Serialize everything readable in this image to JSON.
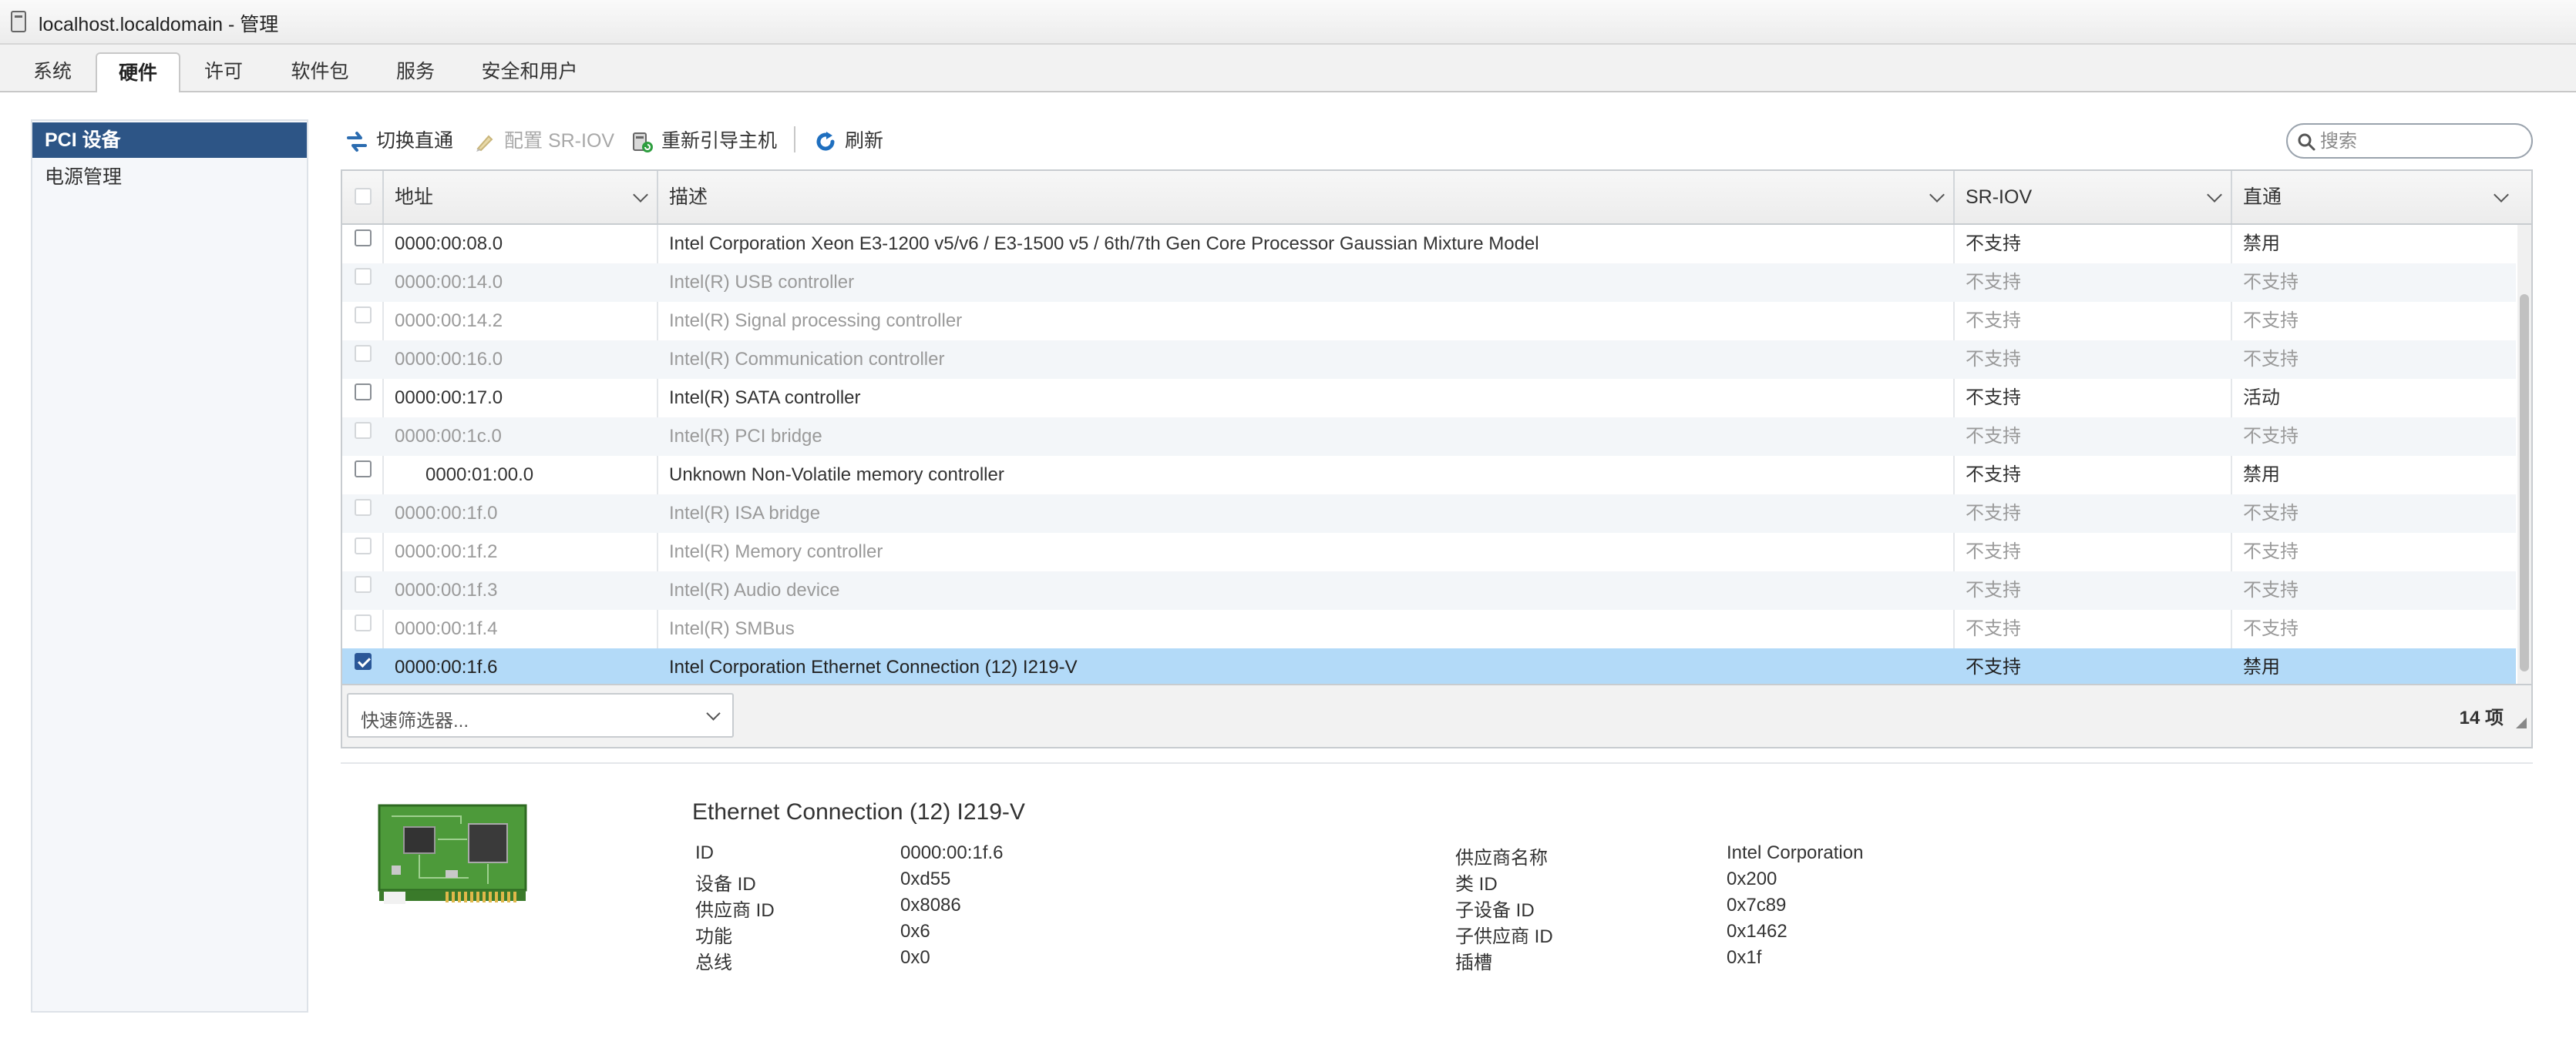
{
  "window": {
    "title": "localhost.localdomain - 管理"
  },
  "tabs": [
    {
      "label": "系统",
      "active": false
    },
    {
      "label": "硬件",
      "active": true
    },
    {
      "label": "许可",
      "active": false
    },
    {
      "label": "软件包",
      "active": false
    },
    {
      "label": "服务",
      "active": false
    },
    {
      "label": "安全和用户",
      "active": false
    }
  ],
  "sidebar": {
    "items": [
      {
        "label": "PCI 设备",
        "active": true
      },
      {
        "label": "电源管理",
        "active": false
      }
    ]
  },
  "toolbar": {
    "toggle_passthrough": "切换直通",
    "configure_sriov": "配置 SR-IOV",
    "reboot_host": "重新引导主机",
    "refresh": "刷新"
  },
  "search": {
    "placeholder": "搜索",
    "value": ""
  },
  "grid": {
    "columns": [
      "地址",
      "描述",
      "SR-IOV",
      "直通"
    ],
    "rows": [
      {
        "address": "0000:00:08.0",
        "description": "Intel Corporation Xeon E3-1200 v5/v6 / E3-1500 v5 / 6th/7th Gen Core Processor Gaussian Mixture Model",
        "sriov": "不支持",
        "passthrough": "禁用",
        "enabled": true,
        "checked": false,
        "indent": false
      },
      {
        "address": "0000:00:14.0",
        "description": "Intel(R) USB controller",
        "sriov": "不支持",
        "passthrough": "不支持",
        "enabled": false,
        "checked": false,
        "indent": false
      },
      {
        "address": "0000:00:14.2",
        "description": "Intel(R) Signal processing controller",
        "sriov": "不支持",
        "passthrough": "不支持",
        "enabled": false,
        "checked": false,
        "indent": false
      },
      {
        "address": "0000:00:16.0",
        "description": "Intel(R) Communication controller",
        "sriov": "不支持",
        "passthrough": "不支持",
        "enabled": false,
        "checked": false,
        "indent": false
      },
      {
        "address": "0000:00:17.0",
        "description": "Intel(R) SATA controller",
        "sriov": "不支持",
        "passthrough": "活动",
        "enabled": true,
        "checked": false,
        "indent": false
      },
      {
        "address": "0000:00:1c.0",
        "description": "Intel(R) PCI bridge",
        "sriov": "不支持",
        "passthrough": "不支持",
        "enabled": false,
        "checked": false,
        "indent": false
      },
      {
        "address": "0000:01:00.0",
        "description": "Unknown Non-Volatile memory controller",
        "sriov": "不支持",
        "passthrough": "禁用",
        "enabled": true,
        "checked": false,
        "indent": true
      },
      {
        "address": "0000:00:1f.0",
        "description": "Intel(R) ISA bridge",
        "sriov": "不支持",
        "passthrough": "不支持",
        "enabled": false,
        "checked": false,
        "indent": false
      },
      {
        "address": "0000:00:1f.2",
        "description": "Intel(R) Memory controller",
        "sriov": "不支持",
        "passthrough": "不支持",
        "enabled": false,
        "checked": false,
        "indent": false
      },
      {
        "address": "0000:00:1f.3",
        "description": "Intel(R) Audio device",
        "sriov": "不支持",
        "passthrough": "不支持",
        "enabled": false,
        "checked": false,
        "indent": false
      },
      {
        "address": "0000:00:1f.4",
        "description": "Intel(R) SMBus",
        "sriov": "不支持",
        "passthrough": "不支持",
        "enabled": false,
        "checked": false,
        "indent": false
      },
      {
        "address": "0000:00:1f.6",
        "description": "Intel Corporation Ethernet Connection (12) I219-V",
        "sriov": "不支持",
        "passthrough": "禁用",
        "enabled": true,
        "checked": true,
        "indent": false
      }
    ],
    "quick_filter": "快速筛选器...",
    "item_count": "14 项"
  },
  "details": {
    "title": "Ethernet Connection (12) I219-V",
    "left": [
      {
        "key": "ID",
        "value": "0000:00:1f.6"
      },
      {
        "key": "设备 ID",
        "value": "0xd55"
      },
      {
        "key": "供应商 ID",
        "value": "0x8086"
      },
      {
        "key": "功能",
        "value": "0x6"
      },
      {
        "key": "总线",
        "value": "0x0"
      }
    ],
    "right": [
      {
        "key": "供应商名称",
        "value": "Intel Corporation"
      },
      {
        "key": "类 ID",
        "value": "0x200"
      },
      {
        "key": "子设备 ID",
        "value": "0x7c89"
      },
      {
        "key": "子供应商 ID",
        "value": "0x1462"
      },
      {
        "key": "插槽",
        "value": "0x1f"
      }
    ]
  },
  "colors": {
    "nav_active": "#2d5586",
    "selected_row": "#b3daf8",
    "accent_blue": "#1f6fbf"
  }
}
